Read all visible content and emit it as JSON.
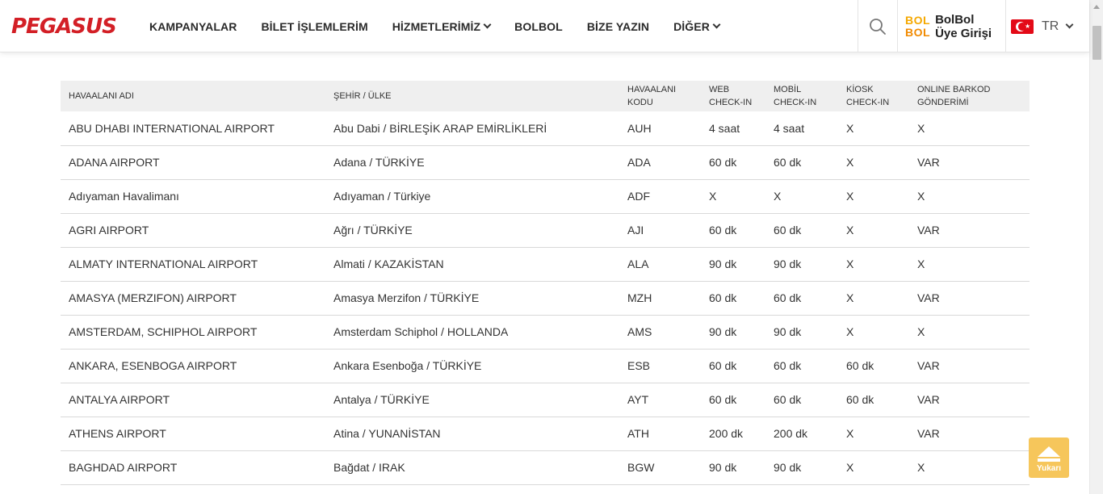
{
  "header": {
    "logo": "PEGASUS",
    "nav": [
      {
        "label": "KAMPANYALAR",
        "dropdown": false
      },
      {
        "label": "BİLET İŞLEMLERİM",
        "dropdown": false
      },
      {
        "label": "HİZMETLERİMİZ",
        "dropdown": true
      },
      {
        "label": "BOLBOL",
        "dropdown": false
      },
      {
        "label": "BİZE YAZIN",
        "dropdown": false
      },
      {
        "label": "DİĞER",
        "dropdown": true
      }
    ],
    "search_icon": "search-icon",
    "bolbol_logo_top": "BOL",
    "bolbol_logo_bottom": "BOL",
    "bolbol_line1": "BolBol",
    "bolbol_line2": "Üye Girişi",
    "language": "TR"
  },
  "table": {
    "headers": {
      "name": "HAVAALANI ADI",
      "city": "ŞEHİR / ÜLKE",
      "code": "HAVAALANI KODU",
      "web": "WEB CHECK-IN",
      "mobile": "MOBİL CHECK-IN",
      "kiosk": "KİOSK CHECK-IN",
      "barcode": "ONLINE BARKOD GÖNDERİMİ"
    },
    "rows": [
      {
        "name": "ABU DHABI INTERNATIONAL AIRPORT",
        "city": "Abu Dabi / BİRLEŞİK ARAP EMİRLİKLERİ",
        "code": "AUH",
        "web": "4 saat",
        "mobile": "4 saat",
        "kiosk": "X",
        "barcode": "X"
      },
      {
        "name": "ADANA AIRPORT",
        "city": "Adana / TÜRKİYE",
        "code": "ADA",
        "web": "60 dk",
        "mobile": "60 dk",
        "kiosk": "X",
        "barcode": "VAR"
      },
      {
        "name": "Adıyaman Havalimanı",
        "city": "Adıyaman / Türkiye",
        "code": "ADF",
        "web": "X",
        "mobile": "X",
        "kiosk": "X",
        "barcode": "X"
      },
      {
        "name": "AGRI AIRPORT",
        "city": "Ağrı / TÜRKİYE",
        "code": "AJI",
        "web": "60 dk",
        "mobile": "60 dk",
        "kiosk": "X",
        "barcode": "VAR"
      },
      {
        "name": "ALMATY INTERNATIONAL AIRPORT",
        "city": "Almati / KAZAKİSTAN",
        "code": "ALA",
        "web": "90 dk",
        "mobile": "90 dk",
        "kiosk": "X",
        "barcode": "X"
      },
      {
        "name": "AMASYA (MERZIFON) AIRPORT",
        "city": "Amasya Merzifon / TÜRKİYE",
        "code": "MZH",
        "web": "60 dk",
        "mobile": "60 dk",
        "kiosk": "X",
        "barcode": "VAR"
      },
      {
        "name": "AMSTERDAM, SCHIPHOL AIRPORT",
        "city": "Amsterdam Schiphol / HOLLANDA",
        "code": "AMS",
        "web": "90 dk",
        "mobile": "90 dk",
        "kiosk": "X",
        "barcode": "X"
      },
      {
        "name": "ANKARA, ESENBOGA AIRPORT",
        "city": "Ankara Esenboğa / TÜRKİYE",
        "code": "ESB",
        "web": "60 dk",
        "mobile": "60 dk",
        "kiosk": "60 dk",
        "barcode": "VAR"
      },
      {
        "name": "ANTALYA AIRPORT",
        "city": "Antalya / TÜRKİYE",
        "code": "AYT",
        "web": "60 dk",
        "mobile": "60 dk",
        "kiosk": "60 dk",
        "barcode": "VAR"
      },
      {
        "name": "ATHENS AIRPORT",
        "city": "Atina / YUNANİSTAN",
        "code": "ATH",
        "web": "200 dk",
        "mobile": "200 dk",
        "kiosk": "X",
        "barcode": "VAR"
      },
      {
        "name": "BAGHDAD AIRPORT",
        "city": "Bağdat / IRAK",
        "code": "BGW",
        "web": "90 dk",
        "mobile": "90 dk",
        "kiosk": "X",
        "barcode": "X"
      }
    ]
  },
  "back_to_top_label": "Yukarı",
  "colors": {
    "brand": "#d31f26",
    "bolbol": "#f5a800",
    "to_top": "#f6c65b"
  }
}
